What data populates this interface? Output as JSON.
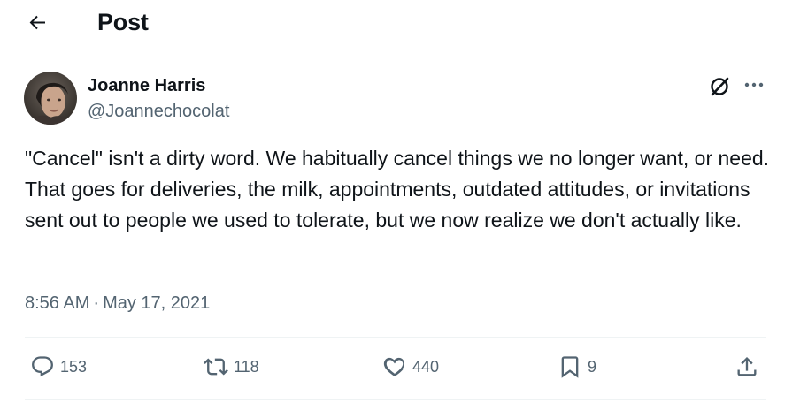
{
  "header": {
    "title": "Post",
    "back_icon": "arrow-left-icon"
  },
  "author": {
    "name": "Joanne Harris",
    "handle": "@Joannechocolat",
    "avatar_icon": "avatar-photo"
  },
  "post": {
    "text": "\"Cancel\" isn't a dirty word. We habitually cancel things we no longer want, or need. That goes for deliveries, the milk, appointments, outdated attitudes, or invitations sent out to people we used to tolerate, but we now realize we don't actually like.",
    "time": "8:56 AM",
    "separator": "·",
    "date": "May 17, 2021"
  },
  "actions": {
    "replies": "153",
    "retweets": "118",
    "likes": "440",
    "bookmarks": "9"
  },
  "colors": {
    "text_primary": "#0f1419",
    "text_secondary": "#536471",
    "divider": "#eff3f4"
  }
}
